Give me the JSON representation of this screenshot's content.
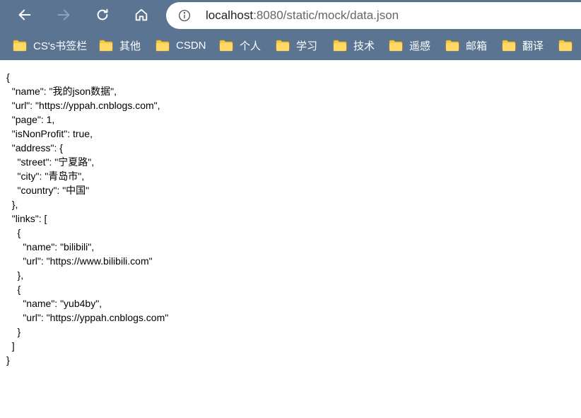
{
  "address_bar": {
    "url_host": "localhost",
    "url_rest": ":8080/static/mock/data.json"
  },
  "nav": {
    "back_icon": "arrow-left-icon",
    "forward_icon": "arrow-right-icon",
    "refresh_icon": "refresh-icon",
    "home_icon": "home-icon",
    "info_icon": "info-circle-icon"
  },
  "bookmarks": [
    {
      "label": "CS's书签栏"
    },
    {
      "label": "其他"
    },
    {
      "label": "CSDN"
    },
    {
      "label": "个人"
    },
    {
      "label": "学习"
    },
    {
      "label": "技术"
    },
    {
      "label": "遥感"
    },
    {
      "label": "邮箱"
    },
    {
      "label": "翻译"
    },
    {
      "label": ""
    }
  ],
  "json_lines": [
    "{",
    "  \"name\": \"我的json数据\",",
    "  \"url\": \"https://yppah.cnblogs.com\",",
    "  \"page\": 1,",
    "  \"isNonProfit\": true,",
    "  \"address\": {",
    "    \"street\": \"宁夏路\",",
    "    \"city\": \"青岛市\",",
    "    \"country\": \"中国\"",
    "  },",
    "  \"links\": [",
    "    {",
    "      \"name\": \"bilibili\",",
    "      \"url\": \"https://www.bilibili.com\"",
    "    },",
    "    {",
    "      \"name\": \"yub4by\",",
    "      \"url\": \"https://yppah.cnblogs.com\"",
    "    }",
    "  ]",
    "}"
  ],
  "colors": {
    "toolbar": "#5a7491",
    "folder": "#f7c948",
    "text": "#000000"
  }
}
